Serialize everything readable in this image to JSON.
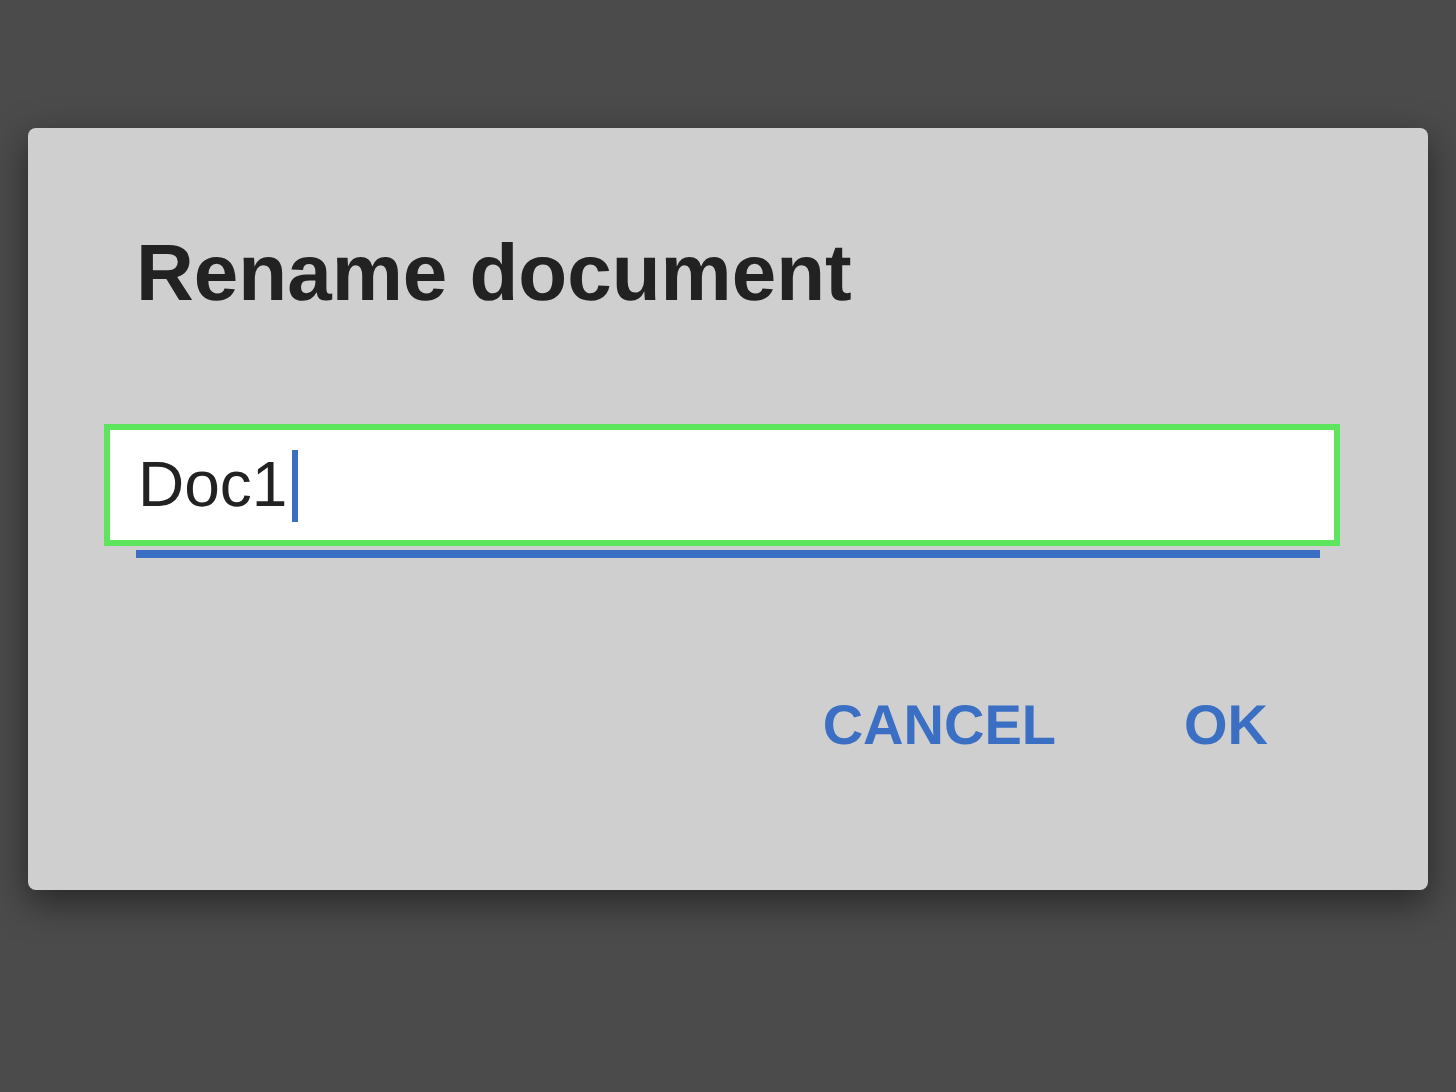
{
  "dialog": {
    "title": "Rename document",
    "field": {
      "value": "Doc1",
      "focused": true
    },
    "buttons": [
      {
        "label": "CANCEL"
      },
      {
        "label": "OK"
      }
    ]
  }
}
